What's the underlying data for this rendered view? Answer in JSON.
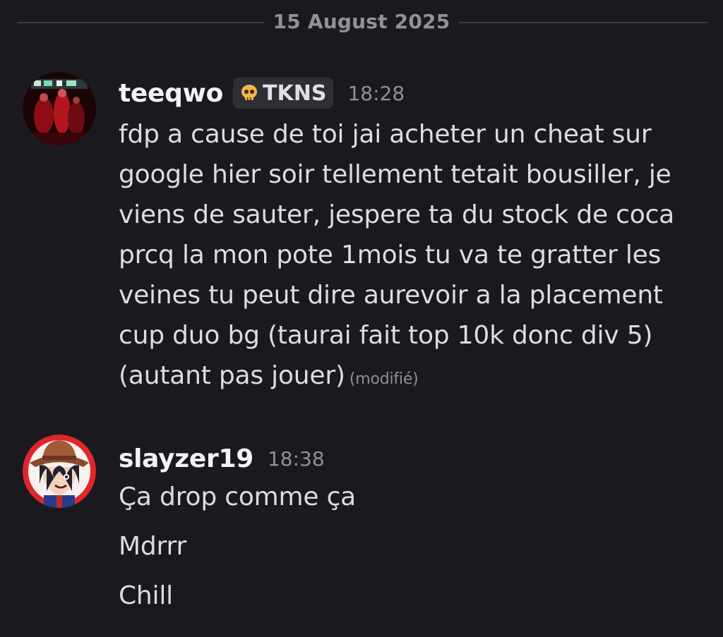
{
  "date_divider": "15 August 2025",
  "messages": [
    {
      "username": "teeqwo",
      "tag": {
        "icon": "skull-icon",
        "text": "TKNS"
      },
      "timestamp": "18:28",
      "content": "fdp a cause de toi jai acheter un cheat sur google hier soir tellement tetait bousiller, je viens de sauter, jespere ta du stock de coca prcq la mon pote 1mois tu va te gratter les veines tu peut dire aurevoir a la placement cup duo bg (taurai fait top 10k donc div 5) (autant pas jouer)",
      "edited": "(modifié)"
    },
    {
      "username": "slayzer19",
      "timestamp": "18:38",
      "lines": [
        "Ça drop comme ça",
        "Mdrrr",
        "Chill"
      ]
    }
  ],
  "colors": {
    "background": "#1a1a1e",
    "username": "#f2f3f5",
    "text": "#dcdde0",
    "muted": "#8e9099",
    "tag_bg": "#2e2f35"
  }
}
